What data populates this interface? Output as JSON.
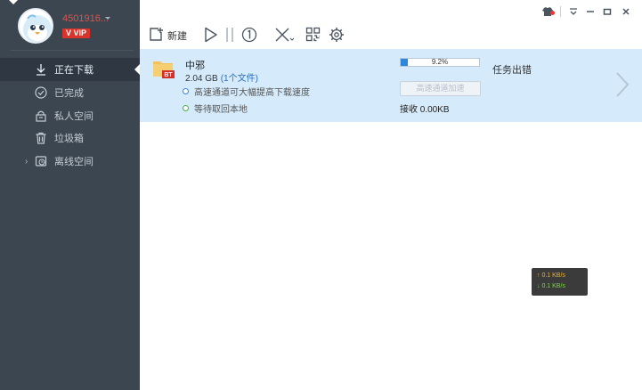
{
  "user": {
    "name": "4501916...",
    "vip_label": "VIP"
  },
  "sidebar": {
    "items": [
      {
        "label": "正在下载",
        "icon": "download-icon"
      },
      {
        "label": "已完成",
        "icon": "check-circle-icon"
      },
      {
        "label": "私人空间",
        "icon": "lock-icon"
      },
      {
        "label": "垃圾箱",
        "icon": "trash-icon"
      },
      {
        "label": "离线空间",
        "icon": "cloud-clock-icon"
      }
    ]
  },
  "toolbar": {
    "new_label": "新建"
  },
  "task": {
    "name": "中邪",
    "size": "2.04 GB",
    "files": "(1个文件)",
    "line1": "高速通道可大幅提高下载速度",
    "line2": "等待取回本地",
    "progress_text": "9.2%",
    "progress_value": 0.092,
    "status": "任务出错",
    "accel_label": "高速通道加速",
    "receive": "接收 0.00KB",
    "badge": "BT"
  },
  "speed": {
    "up": "↑ 0.1 KB/s",
    "down": "↓ 0.1 KB/s"
  },
  "colors": {
    "sidebar_bg": "#3c4651",
    "row_selected_bg": "#d5ebfb",
    "progress_fill": "#2f86da",
    "vip": "#d9342b"
  }
}
